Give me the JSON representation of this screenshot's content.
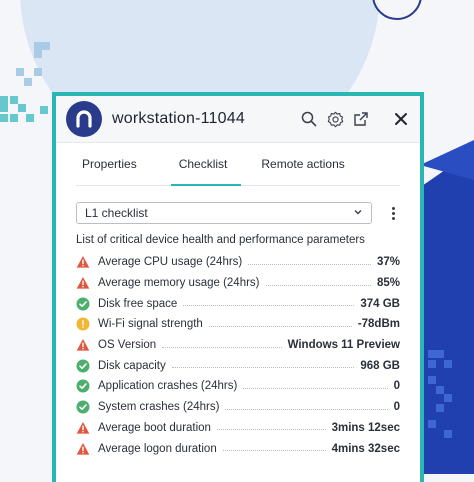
{
  "colors": {
    "accent_teal": "#2ab7b3",
    "brand_navy": "#2b3b8c",
    "status_critical": "#e0573f",
    "status_ok": "#4caf6e",
    "status_warning": "#f2b630"
  },
  "window": {
    "title": "workstation-11044",
    "logo_icon": "nexthink-n-logo",
    "header_icons": [
      "search-icon",
      "gear-icon",
      "external-link-icon",
      "close-icon"
    ]
  },
  "tabs": [
    {
      "label": "Properties",
      "active": false
    },
    {
      "label": "Checklist",
      "active": true
    },
    {
      "label": "Remote actions",
      "active": false
    }
  ],
  "checklist": {
    "selected": "L1 checklist",
    "description": "List of critical device health and performance  parameters",
    "items": [
      {
        "label": "Average CPU usage (24hrs)",
        "value": "37%",
        "status": "critical"
      },
      {
        "label": "Average memory usage (24hrs)",
        "value": "85%",
        "status": "critical"
      },
      {
        "label": "Disk free space",
        "value": "374 GB",
        "status": "ok"
      },
      {
        "label": "Wi-Fi signal strength",
        "value": "-78dBm",
        "status": "warning"
      },
      {
        "label": "OS Version",
        "value": "Windows 11 Preview",
        "status": "critical"
      },
      {
        "label": "Disk capacity",
        "value": "968 GB",
        "status": "ok"
      },
      {
        "label": "Application crashes (24hrs)",
        "value": "0",
        "status": "ok"
      },
      {
        "label": "System crashes (24hrs)",
        "value": "0",
        "status": "ok"
      },
      {
        "label": "Average boot duration",
        "value": "3mins 12sec",
        "status": "critical"
      },
      {
        "label": "Average logon duration",
        "value": "4mins 32sec",
        "status": "critical"
      }
    ]
  }
}
